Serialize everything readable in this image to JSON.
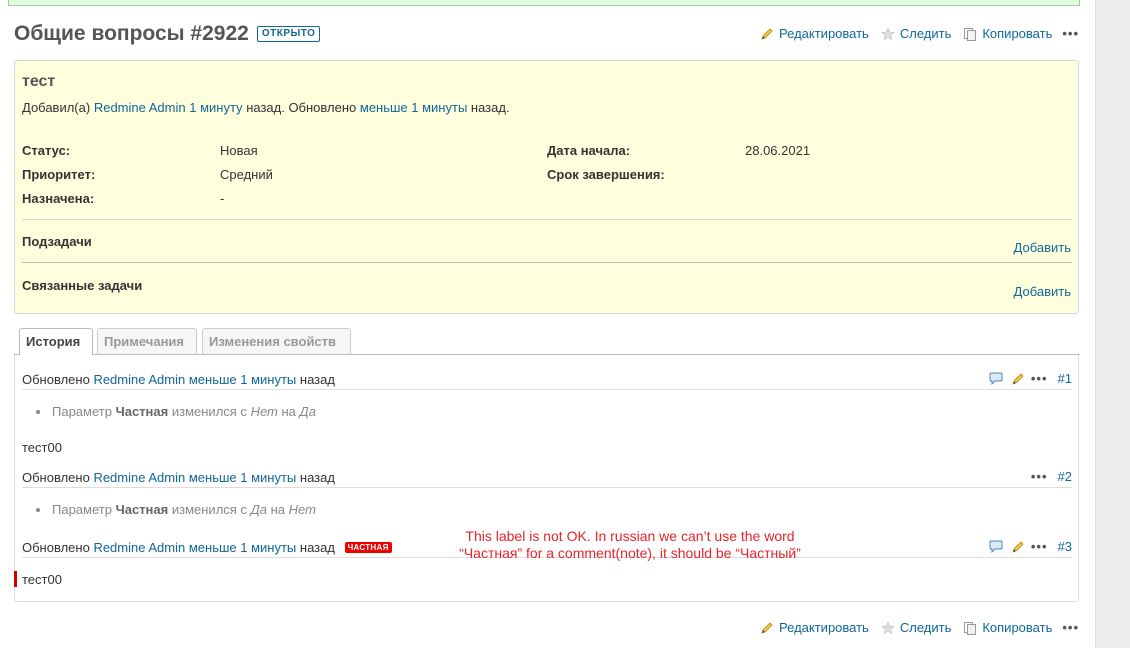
{
  "toolbar": {
    "edit_label": "Редактировать",
    "watch_label": "Следить",
    "copy_label": "Копировать",
    "more_label": "•••"
  },
  "issue": {
    "title": "Общие вопросы #2922",
    "status_badge": "ОТКРЫТО",
    "subject": "тест",
    "author_prefix": "Добавил(а)",
    "author_name": "Redmine Admin",
    "created_ago": "1 минуту",
    "middle_text": "назад. Обновлено",
    "updated_ago": "меньше 1 минуты",
    "suffix_text": "назад.",
    "attributes": {
      "status_label": "Статус:",
      "status_value": "Новая",
      "priority_label": "Приоритет:",
      "priority_value": "Средний",
      "assigned_label": "Назначена:",
      "assigned_value": "-",
      "start_label": "Дата начала:",
      "start_value": "28.06.2021",
      "due_label": "Срок завершения:",
      "due_value": ""
    },
    "subtasks_label": "Подзадачи",
    "subtasks_add": "Добавить",
    "relations_label": "Связанные задачи",
    "relations_add": "Добавить"
  },
  "tabs": [
    {
      "label": "История",
      "active": true
    },
    {
      "label": "Примечания",
      "active": false
    },
    {
      "label": "Изменения свойств",
      "active": false
    }
  ],
  "journals": [
    {
      "prefix": "Обновлено",
      "author": "Redmine Admin",
      "ago": "меньше 1 минуты",
      "suffix": "назад",
      "number": "#1",
      "detail_prefix": "Параметр",
      "detail_field": "Частная",
      "detail_mid": "изменился с",
      "detail_old": "Нет",
      "detail_on": "на",
      "detail_new": "Да",
      "note": "тест00"
    },
    {
      "prefix": "Обновлено",
      "author": "Redmine Admin",
      "ago": "меньше 1 минуты",
      "suffix": "назад",
      "number": "#2",
      "detail_prefix": "Параметр",
      "detail_field": "Частная",
      "detail_mid": "изменился с",
      "detail_old": "Да",
      "detail_on": "на",
      "detail_new": "Нет"
    },
    {
      "prefix": "Обновлено",
      "author": "Redmine Admin",
      "ago": "меньше 1 минуты",
      "suffix": "назад",
      "private_badge": "ЧАСТНАЯ",
      "number": "#3",
      "note": "тест00"
    }
  ],
  "annotation": {
    "line1": "This label is not OK. In russian we can’t use the word",
    "line2": "“Частная” for a comment(note), it should be “Частный”"
  },
  "colors": {
    "link": "#116699",
    "issue_bg": "#ffffdd",
    "private_badge": "#ee0000",
    "annotation": "#e8242b"
  }
}
